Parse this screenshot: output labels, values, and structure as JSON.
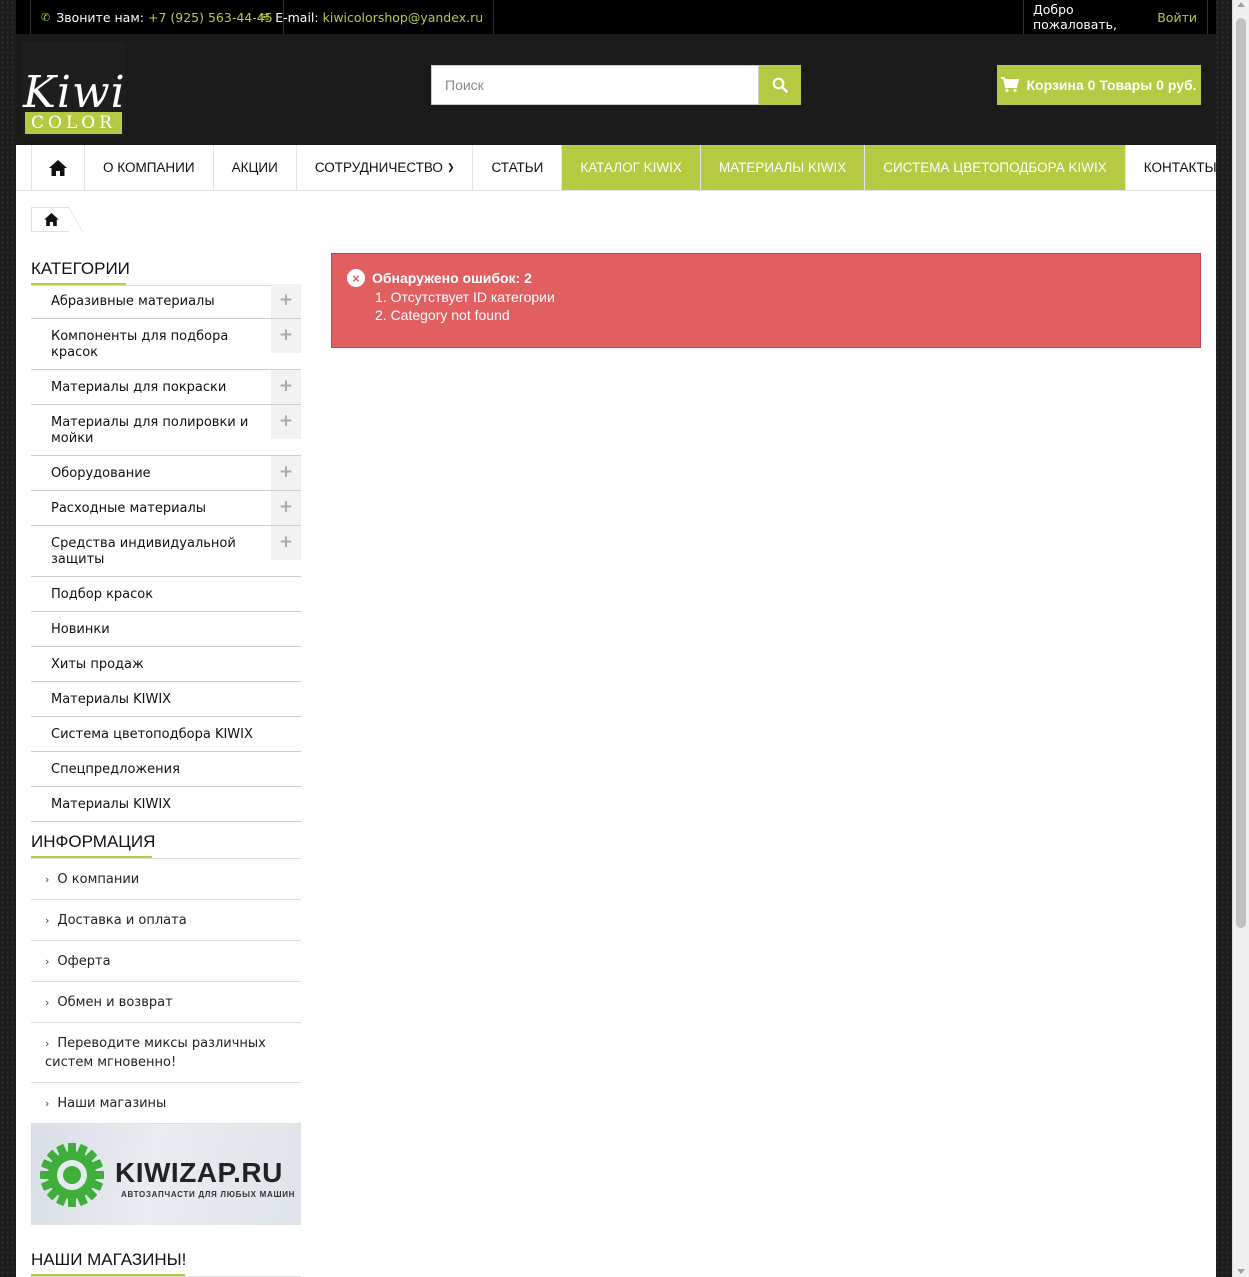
{
  "topbar": {
    "phone_label": "Звоните нам:",
    "phone_number": "+7 (925) 563-44-45",
    "email_label": "E-mail:",
    "email_address": "kiwicolorshop@yandex.ru",
    "welcome_text": "Добро пожаловать,",
    "login_link": "Войти"
  },
  "logo": {
    "word_top": "Kiwi",
    "word_bottom": "COLOR"
  },
  "search": {
    "placeholder": "Поиск",
    "value": ""
  },
  "cart": {
    "label": "Корзина 0 Товары 0 руб."
  },
  "nav": {
    "items": [
      {
        "label": "О КОМПАНИИ"
      },
      {
        "label": "АКЦИИ"
      },
      {
        "label": "СОТРУДНИЧЕСТВО"
      },
      {
        "label": "СТАТЬИ"
      },
      {
        "label": "КАТАЛОГ KIWIX"
      },
      {
        "label": "МАТЕРИАЛЫ KIWIX"
      },
      {
        "label": "СИСТЕМА ЦВЕТОПОДБОРА KIWIX"
      },
      {
        "label": "КОНТАКТЫ"
      }
    ]
  },
  "categories": {
    "title": "Категории",
    "items": [
      {
        "label": "Абразивные материалы",
        "expand": "+"
      },
      {
        "label": "Компоненты для подбора красок",
        "expand": "+"
      },
      {
        "label": "Материалы для покраски",
        "expand": "+"
      },
      {
        "label": "Материалы для полировки и мойки",
        "expand": "+"
      },
      {
        "label": "Оборудование",
        "expand": "+"
      },
      {
        "label": "Расходные материалы",
        "expand": "+"
      },
      {
        "label": "Средства индивидуальной защиты",
        "expand": "+"
      },
      {
        "label": "Подбор красок"
      },
      {
        "label": "Новинки"
      },
      {
        "label": "Хиты продаж"
      },
      {
        "label": "Материалы KIWIX"
      },
      {
        "label": "Система цветоподбора KIWIX"
      },
      {
        "label": "Спецпредложения"
      },
      {
        "label": "Материалы KIWIX"
      }
    ]
  },
  "information": {
    "title": "Информация",
    "items": [
      {
        "label": "О компании"
      },
      {
        "label": "Доставка и оплата"
      },
      {
        "label": "Оферта"
      },
      {
        "label": "Обмен и возврат"
      },
      {
        "label": "Переводите миксы различных систем мгновенно!"
      },
      {
        "label": "Наши магазины"
      }
    ]
  },
  "banner": {
    "title": "KIWIZAP.RU",
    "subtitle": "Автозапчасти для любых машин"
  },
  "stores": {
    "title": "Наши магазины!"
  },
  "alert": {
    "heading": "Обнаружено ошибок: 2",
    "errors": [
      "1. Отсутствует ID категории",
      "2. Category not found"
    ]
  },
  "colors": {
    "accent": "#b6c943",
    "error": "#e15e61",
    "topbar": "#000000"
  }
}
